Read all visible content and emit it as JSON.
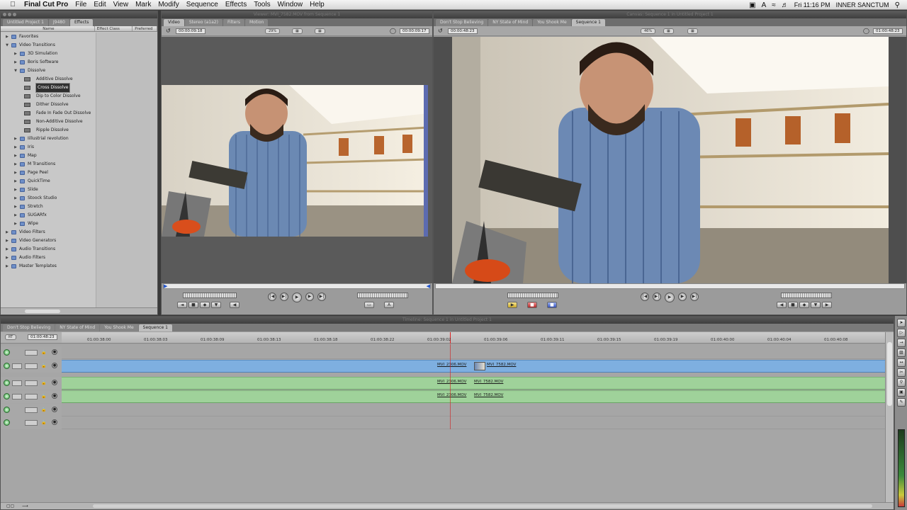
{
  "menubar": {
    "app_name": "Final Cut Pro",
    "items": [
      "File",
      "Edit",
      "View",
      "Mark",
      "Modify",
      "Sequence",
      "Effects",
      "Tools",
      "Window",
      "Help"
    ],
    "clock": "Fri 11:16 PM",
    "user": "INNER SANCTUM"
  },
  "browser": {
    "tabs": [
      "Untitled Project 1",
      "J9480",
      "Effects"
    ],
    "active_tab": "Effects",
    "columns": [
      "Name",
      "Effect Class",
      "Preferred"
    ],
    "tree": [
      {
        "label": "Favorites",
        "level": 0,
        "kind": "folder",
        "open": false
      },
      {
        "label": "Video Transitions",
        "level": 0,
        "kind": "folder",
        "open": true
      },
      {
        "label": "3D Simulation",
        "level": 1,
        "kind": "folder",
        "open": false
      },
      {
        "label": "Boris Software",
        "level": 1,
        "kind": "folder",
        "open": false
      },
      {
        "label": "Dissolve",
        "level": 1,
        "kind": "folder",
        "open": true
      },
      {
        "label": "Additive Dissolve",
        "level": 2,
        "kind": "clip"
      },
      {
        "label": "Cross Dissolve",
        "level": 2,
        "kind": "clip",
        "selected": true
      },
      {
        "label": "Dip to Color Dissolve",
        "level": 2,
        "kind": "clip"
      },
      {
        "label": "Dither Dissolve",
        "level": 2,
        "kind": "clip"
      },
      {
        "label": "Fade In Fade Out Dissolve",
        "level": 2,
        "kind": "clip"
      },
      {
        "label": "Non-Additive Dissolve",
        "level": 2,
        "kind": "clip"
      },
      {
        "label": "Ripple Dissolve",
        "level": 2,
        "kind": "clip"
      },
      {
        "label": "Iillustrial revolution",
        "level": 1,
        "kind": "folder",
        "open": false
      },
      {
        "label": "Iris",
        "level": 1,
        "kind": "folder",
        "open": false
      },
      {
        "label": "Map",
        "level": 1,
        "kind": "folder",
        "open": false
      },
      {
        "label": "M Transitions",
        "level": 1,
        "kind": "folder",
        "open": false
      },
      {
        "label": "Page Peel",
        "level": 1,
        "kind": "folder",
        "open": false
      },
      {
        "label": "QuickTime",
        "level": 1,
        "kind": "folder",
        "open": false
      },
      {
        "label": "Slide",
        "level": 1,
        "kind": "folder",
        "open": false
      },
      {
        "label": "Stoock Studio",
        "level": 1,
        "kind": "folder",
        "open": false
      },
      {
        "label": "Stretch",
        "level": 1,
        "kind": "folder",
        "open": false
      },
      {
        "label": "SUGARfx",
        "level": 1,
        "kind": "folder",
        "open": false
      },
      {
        "label": "Wipe",
        "level": 1,
        "kind": "folder",
        "open": false
      },
      {
        "label": "Video Filters",
        "level": 0,
        "kind": "folder",
        "open": false
      },
      {
        "label": "Video Generators",
        "level": 0,
        "kind": "folder",
        "open": false
      },
      {
        "label": "Audio Transitions",
        "level": 0,
        "kind": "folder",
        "open": false
      },
      {
        "label": "Audio Filters",
        "level": 0,
        "kind": "folder",
        "open": false
      },
      {
        "label": "Master Templates",
        "level": 0,
        "kind": "folder",
        "open": false
      }
    ]
  },
  "viewer": {
    "title": "Viewer: MVI_7582.MOV from Sequence 1",
    "tabs": [
      "Video",
      "Stereo (a1a2)",
      "Filters",
      "Motion"
    ],
    "duration": "00:00:09:18",
    "zoom": "29%",
    "current_tc": "00:00:09:17"
  },
  "canvas": {
    "title": "Canvas: Sequence 1 in Untitled Project 1",
    "tabs": [
      "Don't Stop Believing",
      "NY State of Mind",
      "You Shook Me",
      "Sequence 1"
    ],
    "duration": "00:00:48:23",
    "zoom": "46%",
    "current_tc": "01:00:48:23"
  },
  "timeline": {
    "title": "Timeline: Sequence 1 in Untitled Project 1",
    "tabs": [
      "Don't Stop Believing",
      "NY State of Mind",
      "You Shook Me",
      "Sequence 1"
    ],
    "current_tc": "01:00:48:23",
    "rt_label": "RT",
    "ruler": [
      "01:00:38:00",
      "01:00:38:03",
      "01:00:38:09",
      "01:00:38:13",
      "01:00:38:18",
      "01:00:38:22",
      "01:00:39:02",
      "01:00:39:06",
      "01:00:39:11",
      "01:00:39:15",
      "01:00:39:19",
      "01:00:40:00",
      "01:00:40:04",
      "01:00:40:08"
    ],
    "tracks": [
      {
        "name": "V2",
        "src": "",
        "type": "empty"
      },
      {
        "name": "V1",
        "src": "v1",
        "type": "video",
        "clips": [
          "MVI_2306.MOV",
          "MVI_7582.MOV"
        ]
      },
      {
        "name": "A1",
        "src": "a1",
        "type": "audio",
        "clips": [
          "MVI_2306.MOV",
          "MVI_7582.MOV"
        ]
      },
      {
        "name": "A2",
        "src": "a2",
        "type": "audio",
        "clips": [
          "MVI_2306.MOV",
          "MVI_7582.MOV"
        ]
      },
      {
        "name": "A3",
        "src": "",
        "type": "empty"
      },
      {
        "name": "A4",
        "src": "",
        "type": "empty"
      }
    ]
  },
  "colors": {
    "video_track": "#7eafe0",
    "audio_track": "#9fd29a",
    "chrome": "#9b9b9b"
  }
}
